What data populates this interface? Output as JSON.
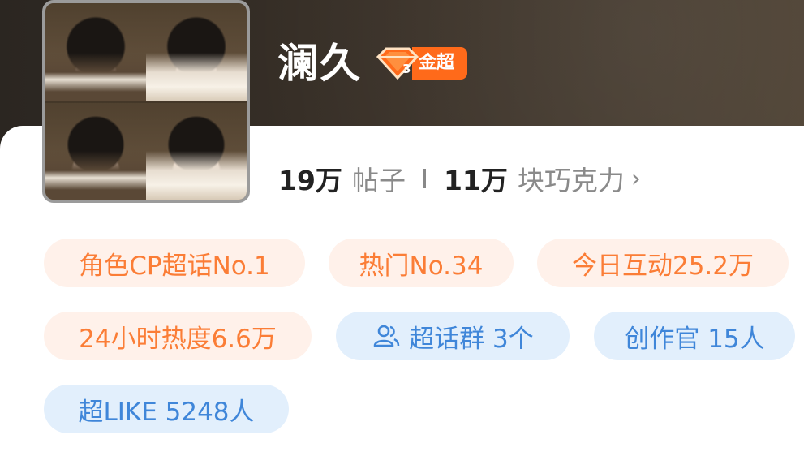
{
  "profile": {
    "name": "澜久",
    "badge_label": "金超",
    "badge_level": "3"
  },
  "stats": {
    "posts_value": "19万",
    "posts_unit": "帖子",
    "chocolate_value": "11万",
    "chocolate_unit": "块巧克力",
    "chevron": "›"
  },
  "tags": {
    "cp_rank": "角色CP超话No.1",
    "hot_rank": "热门No.34",
    "today_interaction": "今日互动25.2万",
    "heat_24h": "24小时热度6.6万",
    "groups": "超话群 3个",
    "creators": "创作官 15人",
    "super_like": "超LIKE 5248人"
  },
  "colors": {
    "accent_orange": "#fb7d36",
    "accent_blue": "#3f86d9",
    "badge_orange": "#ff6a1a",
    "header_dark": "#2b2621"
  },
  "icons": {
    "badge": "diamond-gem-icon",
    "groups": "people-icon",
    "stats_more": "chevron-right-icon"
  }
}
